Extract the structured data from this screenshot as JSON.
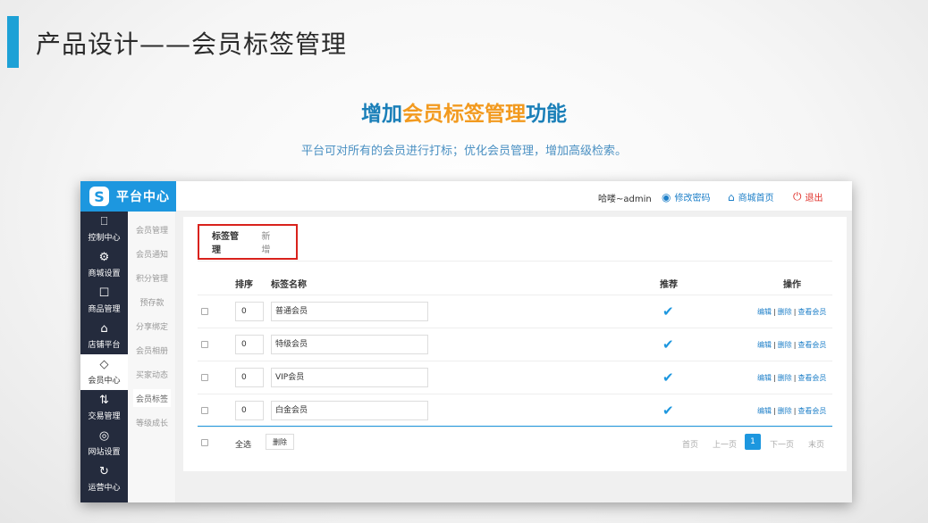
{
  "slide": {
    "title": "产品设计——会员标签管理",
    "headline_pre": "增加",
    "headline_hl": "会员标签管理",
    "headline_post": "功能",
    "subline": "平台可对所有的会员进行打标；优化会员管理，增加高级检索。"
  },
  "colors": {
    "accent": "#1d97df",
    "sidebar": "#242b3d",
    "highlight_orange": "#f29a1f",
    "tab_outline_red": "#d9221c",
    "logout_red": "#e0322b"
  },
  "brand": {
    "logo": "S",
    "name": "平台中心"
  },
  "topbar": {
    "user": "哈喽~admin",
    "change_password": "修改密码",
    "home": "商城首页",
    "logout": "退出"
  },
  "sidebar": {
    "items": [
      {
        "label": "控制中心",
        "icon": "monitor-icon"
      },
      {
        "label": "商城设置",
        "icon": "gear-icon"
      },
      {
        "label": "商品管理",
        "icon": "box-icon"
      },
      {
        "label": "店铺平台",
        "icon": "store-icon"
      },
      {
        "label": "会员中心",
        "icon": "diamond-icon"
      },
      {
        "label": "交易管理",
        "icon": "swap-icon"
      },
      {
        "label": "网站设置",
        "icon": "globe-icon"
      },
      {
        "label": "运营中心",
        "icon": "refresh-icon"
      }
    ],
    "sub_items": [
      {
        "label": "会员管理"
      },
      {
        "label": "会员通知"
      },
      {
        "label": "积分管理"
      },
      {
        "label": "预存款"
      },
      {
        "label": "分享绑定"
      },
      {
        "label": "会员相册"
      },
      {
        "label": "买家动态"
      },
      {
        "label": "会员标签"
      },
      {
        "label": "等级成长"
      }
    ]
  },
  "tabs": [
    {
      "label": "标签管理"
    },
    {
      "label": "新增"
    }
  ],
  "table": {
    "headers": {
      "sort": "排序",
      "name": "标签名称",
      "recommend": "推荐",
      "ops": "操作"
    },
    "rows": [
      {
        "sort": "0",
        "name": "普通会员",
        "recommended": "✔"
      },
      {
        "sort": "0",
        "name": "特级会员",
        "recommended": "✔"
      },
      {
        "sort": "0",
        "name": "VIP会员",
        "recommended": "✔"
      },
      {
        "sort": "0",
        "name": "白金会员",
        "recommended": "✔"
      }
    ],
    "ops": {
      "edit": "编辑",
      "delete": "删除",
      "view": "查看会员",
      "sep": "|"
    }
  },
  "footer": {
    "select_all": "全选",
    "delete": "删除",
    "pagination": {
      "first": "首页",
      "prev": "上一页",
      "current": "1",
      "next": "下一页",
      "last": "末页"
    }
  }
}
